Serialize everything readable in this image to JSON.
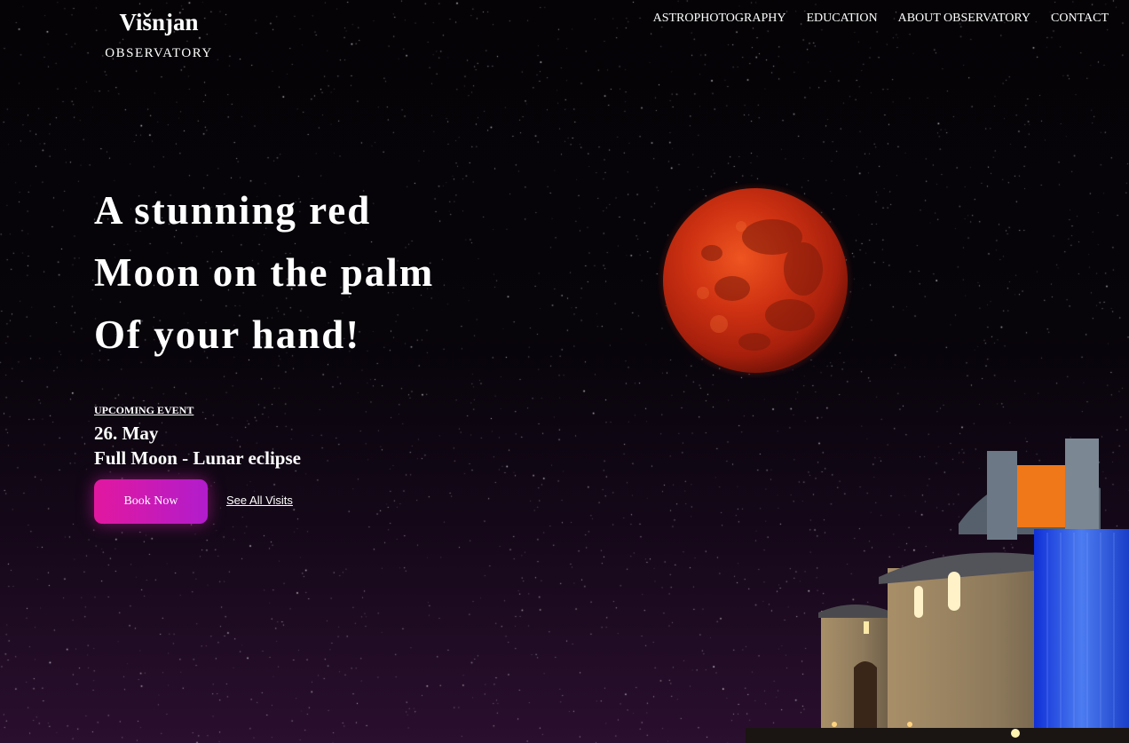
{
  "logo": {
    "title": "Višnjan",
    "subtitle": "OBSERVATORY"
  },
  "nav": {
    "items": [
      {
        "label": "ASTROPHOTOGRAPHY"
      },
      {
        "label": "EDUCATION"
      },
      {
        "label": "ABOUT OBSERVATORY"
      },
      {
        "label": "CONTACT"
      }
    ]
  },
  "hero": {
    "headline_lines": [
      "A stunning red",
      "Moon on the palm",
      "Of your hand!"
    ]
  },
  "event": {
    "label": "UPCOMING EVENT",
    "date": "26. May",
    "name": "Full Moon - Lunar eclipse",
    "book_label": "Book Now",
    "see_all_label": "See All Visits"
  },
  "colors": {
    "accent_start": "#e2189f",
    "accent_end": "#b11ccc",
    "moon": "#c62b10",
    "background": "#050306"
  },
  "icons": {
    "moon": "red-moon-image",
    "observatory": "observatory-building-image"
  }
}
